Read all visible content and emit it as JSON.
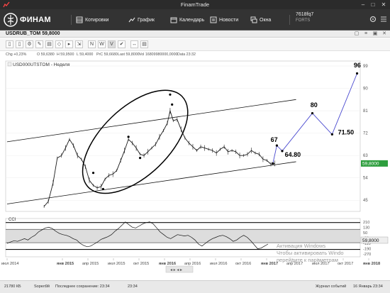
{
  "window": {
    "title": "FinamTrade"
  },
  "brand": {
    "logo_text": "ФИНАМ"
  },
  "nav": {
    "items": [
      {
        "label": "Котировки",
        "icon": "quotes-icon"
      },
      {
        "label": "График",
        "icon": "chart-icon"
      },
      {
        "label": "Календарь",
        "icon": "calendar-icon"
      },
      {
        "label": "Новости",
        "icon": "news-icon"
      },
      {
        "label": "Окна",
        "icon": "windows-icon"
      }
    ],
    "account": {
      "id": "7618fq7",
      "market": "FORTS"
    }
  },
  "panel": {
    "symbol_title": "USDRUB_TOM 59,8000"
  },
  "toolbar": {
    "buttons": [
      {
        "label": "▯",
        "icon": "new-doc-icon"
      },
      {
        "label": "▯",
        "icon": "copy-icon"
      },
      {
        "label": "⚙",
        "icon": "settings-icon"
      },
      {
        "label": "✎",
        "icon": "pencil-icon"
      },
      {
        "label": "▤",
        "icon": "indicators-icon"
      },
      {
        "label": "◇",
        "icon": "shapes-icon"
      },
      {
        "label": "▸",
        "icon": "play-icon"
      },
      {
        "label": "⇲",
        "icon": "export-icon"
      },
      {
        "label": "N",
        "icon": "n-wave-icon"
      },
      {
        "label": "W",
        "icon": "w-wave-icon"
      },
      {
        "label": "V",
        "icon": "v-wave-icon"
      },
      {
        "label": "✔",
        "icon": "check-icon"
      },
      {
        "label": "↔",
        "icon": "fit-icon"
      },
      {
        "label": "▤",
        "icon": "grid-icon"
      }
    ]
  },
  "info": {
    "chg": "Chg +0,23%",
    "o": "O 59,6380",
    "h": "H 59,9500",
    "l": "L 59,4000",
    "prc": "PrC 59,6680",
    "last": "Last 59,8000",
    "vol": "Vol 16809980000,0000",
    "date": "Data 23:32"
  },
  "chart_data": {
    "type": "line",
    "title": "USD000UTSTOM - Неделя",
    "y_ticks": [
      45,
      54,
      63,
      72,
      81,
      90,
      99
    ],
    "ylim": [
      40.5,
      101
    ],
    "x_ticks": [
      "июл 2014",
      "янв 2015",
      "апр 2015",
      "июл 2015",
      "окт 2015",
      "янв 2016",
      "апр 2016",
      "июл 2016",
      "окт 2016",
      "янв 2017",
      "апр 2017",
      "июл 2017",
      "окт 2017",
      "янв 2018"
    ],
    "x_tick_dates": [
      "2014-07-01",
      "2015-01-01",
      "2015-04-01",
      "2015-07-01",
      "2015-10-01",
      "2016-01-01",
      "2016-04-01",
      "2016-07-01",
      "2016-10-01",
      "2017-01-01",
      "2017-04-01",
      "2017-07-01",
      "2017-10-01",
      "2018-01-01"
    ],
    "last_price": {
      "label": "59,8000",
      "value": 59.8
    },
    "price_series": [
      [
        "2014-11-01",
        42.5
      ],
      [
        "2014-11-15",
        44.5
      ],
      [
        "2014-12-01",
        52
      ],
      [
        "2014-12-15",
        62
      ],
      [
        "2014-12-29",
        63
      ],
      [
        "2015-01-12",
        66
      ],
      [
        "2015-01-26",
        69.5
      ],
      [
        "2015-02-09",
        67
      ],
      [
        "2015-02-23",
        63
      ],
      [
        "2015-03-09",
        61.5
      ],
      [
        "2015-03-23",
        58.5
      ],
      [
        "2015-04-06",
        53
      ],
      [
        "2015-04-20",
        51
      ],
      [
        "2015-05-04",
        50
      ],
      [
        "2015-05-18",
        50.5
      ],
      [
        "2015-06-01",
        53.5
      ],
      [
        "2015-06-15",
        55
      ],
      [
        "2015-06-29",
        55.5
      ],
      [
        "2015-07-13",
        57
      ],
      [
        "2015-07-27",
        61
      ],
      [
        "2015-08-10",
        65
      ],
      [
        "2015-08-24",
        69.5
      ],
      [
        "2015-09-07",
        68
      ],
      [
        "2015-09-21",
        66
      ],
      [
        "2015-10-05",
        63.5
      ],
      [
        "2015-10-19",
        63
      ],
      [
        "2015-11-02",
        64.5
      ],
      [
        "2015-11-16",
        66
      ],
      [
        "2015-11-30",
        67.5
      ],
      [
        "2015-12-14",
        70.5
      ],
      [
        "2015-12-28",
        73
      ],
      [
        "2016-01-11",
        76
      ],
      [
        "2016-01-21",
        81
      ],
      [
        "2016-02-01",
        77
      ],
      [
        "2016-02-15",
        77.5
      ],
      [
        "2016-02-29",
        73.5
      ],
      [
        "2016-03-14",
        70
      ],
      [
        "2016-03-28",
        68
      ],
      [
        "2016-04-11",
        66.5
      ],
      [
        "2016-04-25",
        65
      ],
      [
        "2016-05-09",
        66.5
      ],
      [
        "2016-05-23",
        66
      ],
      [
        "2016-06-06",
        65.5
      ],
      [
        "2016-06-20",
        65
      ],
      [
        "2016-07-04",
        64
      ],
      [
        "2016-07-18",
        65.5
      ],
      [
        "2016-08-01",
        66.5
      ],
      [
        "2016-08-15",
        64.5
      ],
      [
        "2016-08-29",
        65
      ],
      [
        "2016-09-12",
        64.5
      ],
      [
        "2016-09-26",
        63
      ],
      [
        "2016-10-10",
        63
      ],
      [
        "2016-10-24",
        63.5
      ],
      [
        "2016-11-07",
        65
      ],
      [
        "2016-11-21",
        64
      ],
      [
        "2016-12-05",
        63.5
      ],
      [
        "2016-12-19",
        61.5
      ],
      [
        "2017-01-02",
        61
      ],
      [
        "2017-01-16",
        59.5
      ],
      [
        "2017-01-30",
        59.8
      ]
    ],
    "upper_channel": [
      [
        "2014-07-01",
        68.5
      ],
      [
        "2017-04-15",
        85.5
      ]
    ],
    "lower_channel": [
      [
        "2014-07-01",
        43.5
      ],
      [
        "2017-04-15",
        60.5
      ]
    ],
    "swing_points": [
      [
        "2015-04-20",
        56
      ],
      [
        "2015-05-25",
        49.5
      ],
      [
        "2015-08-24",
        70.5
      ],
      [
        "2015-10-05",
        62
      ],
      [
        "2016-01-21",
        87.5
      ],
      [
        "2016-01-28",
        83.5
      ]
    ],
    "forecast_path": [
      [
        "2017-01-23",
        59.8
      ],
      [
        "2017-02-06",
        67
      ],
      [
        "2017-02-25",
        64.8
      ],
      [
        "2017-06-12",
        80
      ],
      [
        "2017-08-22",
        71.5
      ],
      [
        "2017-11-20",
        96
      ]
    ],
    "annotations": [
      {
        "text": "67",
        "date": "2017-01-15",
        "value": 68.5
      },
      {
        "text": "64.80",
        "date": "2017-03-06",
        "value": 62.5
      },
      {
        "text": "80",
        "date": "2017-06-05",
        "value": 82.5
      },
      {
        "text": "71.50",
        "date": "2017-09-12",
        "value": 71.5
      },
      {
        "text": "96",
        "date": "2017-11-08",
        "value": 98.5
      }
    ],
    "sub_chart": {
      "title": "CCI",
      "y_ticks": [
        210,
        130,
        50,
        -30,
        -110,
        -190,
        -270
      ],
      "ylim": [
        -300,
        250
      ],
      "levels": [
        200,
        100,
        -100,
        -200
      ],
      "last_label": "59,8000",
      "values": [
        -110,
        -90,
        -70,
        -80,
        -60,
        -40,
        -60,
        -20,
        10,
        60,
        90,
        120,
        130,
        110,
        70,
        40,
        20,
        10,
        -10,
        -40,
        -60,
        -110,
        -140,
        -160,
        -150,
        -120,
        -90,
        -50,
        -30,
        -10,
        20,
        70,
        110,
        160,
        210,
        170,
        130,
        120,
        150,
        180,
        200,
        210,
        180,
        120,
        60,
        20,
        -20,
        -40,
        -10,
        20,
        10,
        0,
        10,
        -20,
        -60,
        -120,
        -150,
        -110,
        -70,
        -40,
        -20,
        0,
        10,
        -10,
        -40,
        -80,
        -60,
        -20,
        10,
        -20,
        -70,
        -130,
        -190,
        -180,
        -150,
        -120
      ]
    }
  },
  "watermark": {
    "line1": "Активация Windows",
    "line2": "Чтобы активировать Windo",
    "line3": "перейдите к параметрам"
  },
  "status": {
    "size": "21780 КБ",
    "server": "Sорел9й",
    "saved": "Последнее сохранение: 23:34",
    "clock": "23:34",
    "journal": "Журнал событий",
    "date": "16 Январь 23:34"
  }
}
